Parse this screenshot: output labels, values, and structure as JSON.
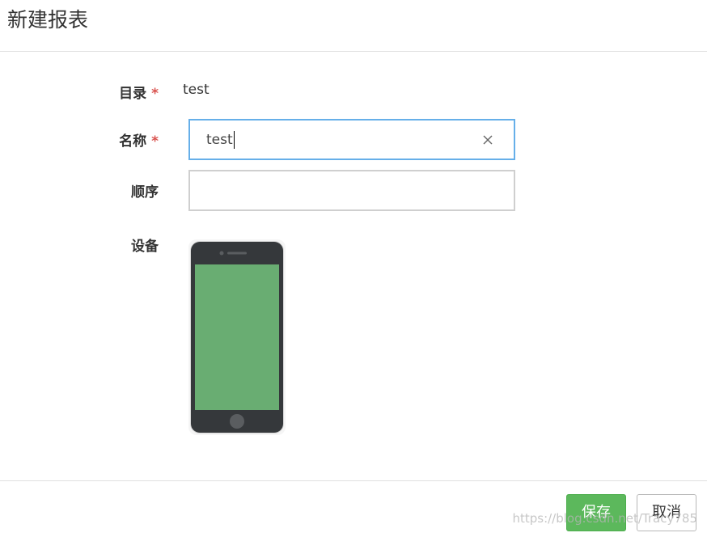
{
  "dialog": {
    "title": "新建报表"
  },
  "form": {
    "directory": {
      "label": "目录",
      "required_mark": "*",
      "value": "test"
    },
    "name": {
      "label": "名称",
      "required_mark": "*",
      "value": "test",
      "placeholder": "",
      "clear_icon": "close-icon"
    },
    "order": {
      "label": "顺序",
      "value": "",
      "placeholder": ""
    },
    "device": {
      "label": "设备",
      "icon": "mobile-phone-icon"
    }
  },
  "footer": {
    "save_label": "保存",
    "cancel_label": "取消"
  },
  "watermark": "https://blog.csdn.net/Tracy785",
  "colors": {
    "primary_green": "#5cb85c",
    "focus_border": "#66afe9",
    "required_red": "#d9534f",
    "phone_screen": "#69ad72",
    "phone_body": "#35383b"
  }
}
